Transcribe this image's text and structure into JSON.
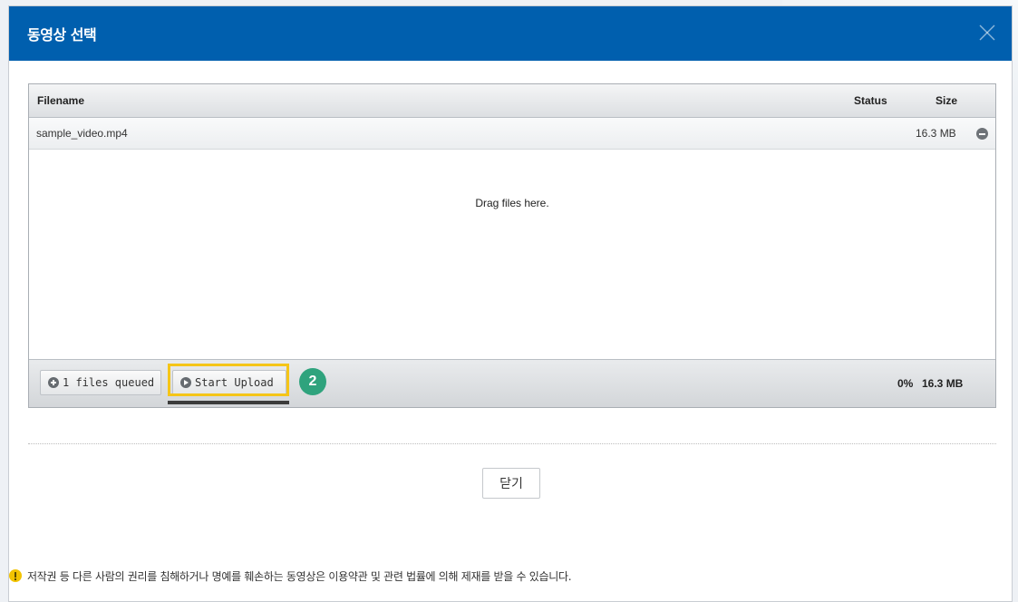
{
  "dialog": {
    "title": "동영상 선택",
    "close_icon": "close-icon"
  },
  "uploader": {
    "columns": {
      "filename": "Filename",
      "status": "Status",
      "size": "Size"
    },
    "files": [
      {
        "name": "sample_video.mp4",
        "status": "",
        "size": "16.3 MB"
      }
    ],
    "drop_hint": "Drag files here.",
    "footer": {
      "queue_button": "1 files queued",
      "start_button": "Start Upload",
      "percent": "0%",
      "total_size": "16.3 MB"
    }
  },
  "annotation": {
    "step": "2",
    "highlight_color": "#f5c518",
    "badge_color": "#2fa37d"
  },
  "footer": {
    "close_button": "닫기",
    "notice": "저작권 등 다른 사람의 권리를 침해하거나 명예를 훼손하는 동영상은 이용약관 및 관련 법률에 의해 제재를 받을 수 있습니다."
  },
  "colors": {
    "header": "#005fae",
    "warning": "#f2c300"
  }
}
